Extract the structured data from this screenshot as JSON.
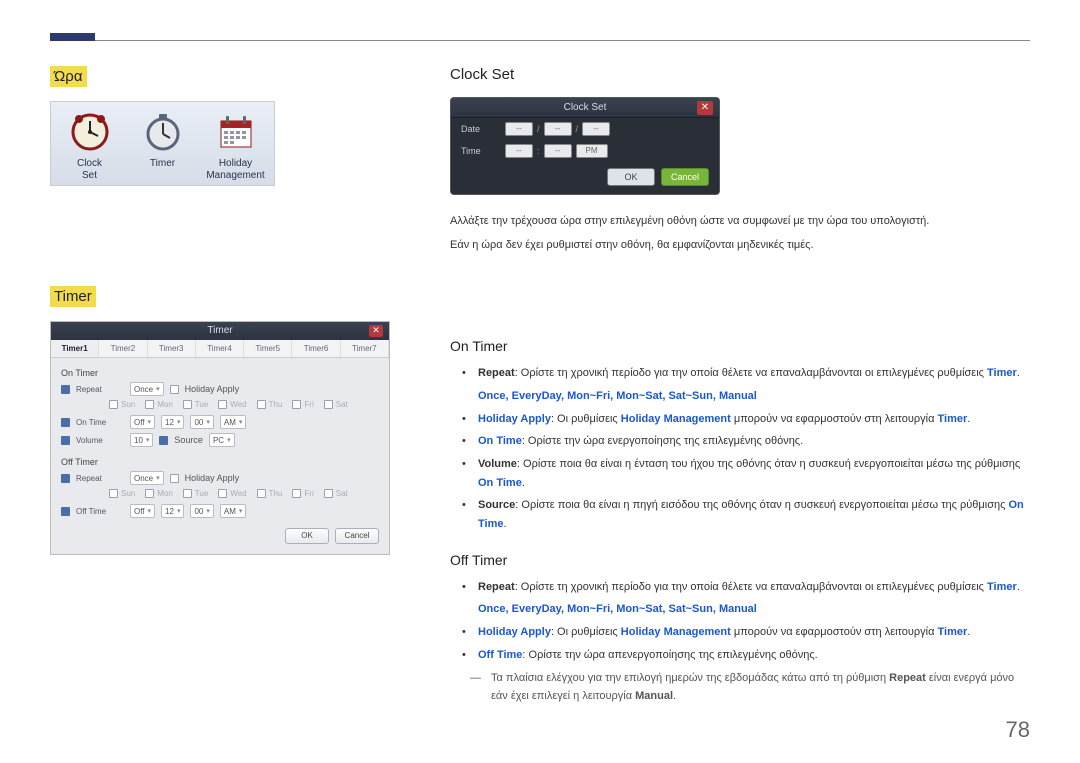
{
  "page_number": "78",
  "left": {
    "heading_time": "Ώρα",
    "heading_timer": "Timer",
    "icons": {
      "clock_set": "Clock\nSet",
      "timer": "Timer",
      "holiday": "Holiday\nManagement"
    },
    "timer_panel": {
      "title": "Timer",
      "tabs": [
        "Timer1",
        "Timer2",
        "Timer3",
        "Timer4",
        "Timer5",
        "Timer6",
        "Timer7"
      ],
      "on_timer": "On Timer",
      "off_timer": "Off Timer",
      "repeat_label": "Repeat",
      "repeat_value": "Once",
      "holiday_apply": "Holiday Apply",
      "days": [
        "Sun",
        "Mon",
        "Tue",
        "Wed",
        "Thu",
        "Fri",
        "Sat"
      ],
      "on_time_label": "On Time",
      "off_time_label": "Off Time",
      "on_time_on": "Off",
      "time_h": "12",
      "time_m": "00",
      "time_ampm": "AM",
      "volume_label": "Volume",
      "volume_value": "10",
      "source_label": "Source",
      "source_value": "PC",
      "ok": "OK",
      "cancel": "Cancel"
    }
  },
  "right": {
    "clockset_heading": "Clock Set",
    "clockset_panel": {
      "title": "Clock Set",
      "date_label": "Date",
      "time_label": "Time",
      "placeholder": "--",
      "pm": "PM",
      "ok": "OK",
      "cancel": "Cancel"
    },
    "clockset_para1": "Αλλάξτε την τρέχουσα ώρα στην επιλεγμένη οθόνη ώστε να συμφωνεί με την ώρα του υπολογιστή.",
    "clockset_para2": "Εάν η ώρα δεν έχει ρυθμιστεί στην οθόνη, θα εμφανίζονται μηδενικές τιμές.",
    "on_timer_heading": "On Timer",
    "on_timer": {
      "li1_pre": "Repeat",
      "li1_text": ": Ορίστε τη χρονική περίοδο για την οποία θέλετε να επαναλαμβάνονται οι επιλεγμένες ρυθμίσεις ",
      "li1_end": "Timer",
      "options": "Once, EveryDay, Mon~Fri, Mon~Sat, Sat~Sun, Manual",
      "li2_pre": "Holiday Apply",
      "li2_mid": ": Οι ρυθμίσεις ",
      "li2_hm": "Holiday Management",
      "li2_mid2": " μπορούν να εφαρμοστούν στη λειτουργία ",
      "li2_end": "Timer",
      "li3_pre": "On Time",
      "li3_text": ": Ορίστε την ώρα ενεργοποίησης της επιλεγμένης οθόνης.",
      "li4_pre": "Volume",
      "li4_text": ": Ορίστε ποια θα είναι η ένταση του ήχου της οθόνης όταν η συσκευή ενεργοποιείται μέσω της ρύθμισης ",
      "li4_end": "On Time",
      "li5_pre": "Source",
      "li5_text": ": Ορίστε ποια θα είναι η πηγή εισόδου της οθόνης όταν η συσκευή ενεργοποιείται μέσω της ρύθμισης ",
      "li5_end": "On Time"
    },
    "off_timer_heading": "Off Timer",
    "off_timer": {
      "li1_pre": "Repeat",
      "li1_text": ": Ορίστε τη χρονική περίοδο για την οποία θέλετε να επαναλαμβάνονται οι επιλεγμένες ρυθμίσεις ",
      "li1_end": "Timer",
      "options": "Once, EveryDay, Mon~Fri, Mon~Sat, Sat~Sun, Manual",
      "li2_pre": "Holiday Apply",
      "li2_mid": ": Οι ρυθμίσεις ",
      "li2_hm": "Holiday Management",
      "li2_mid2": " μπορούν να εφαρμοστούν στη λειτουργία ",
      "li2_end": "Timer",
      "li3_pre": "Off Time",
      "li3_text": ": Ορίστε την ώρα απενεργοποίησης της επιλεγμένης οθόνης."
    },
    "footnote": {
      "dash": "―",
      "pre": "Τα πλαίσια ελέγχου για την επιλογή ημερών της εβδομάδας κάτω από τη ρύθμιση ",
      "repeat": "Repeat",
      "mid": " είναι ενεργά μόνο εάν έχει επιλεγεί η λειτουργία ",
      "manual": "Manual",
      "end": "."
    }
  }
}
